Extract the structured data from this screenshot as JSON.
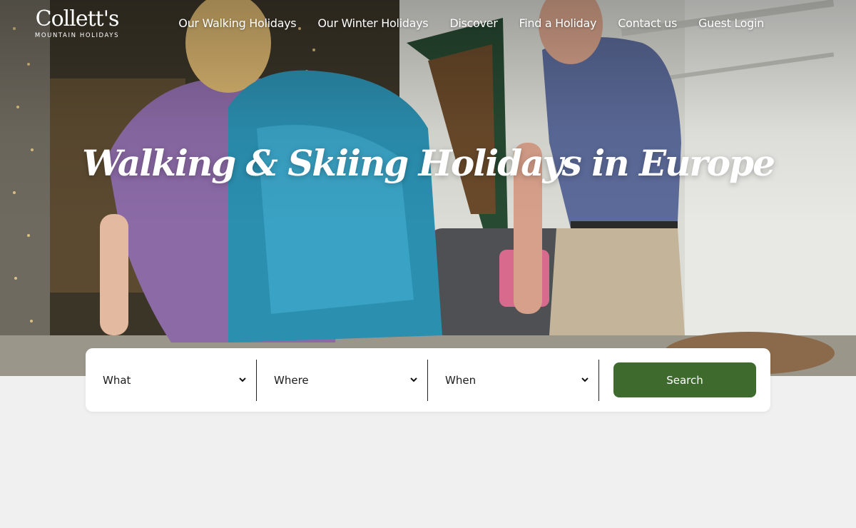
{
  "brand": {
    "wordmark": "Collett's",
    "tagline": "MOUNTAIN HOLIDAYS"
  },
  "nav": {
    "items": [
      {
        "label": "Our Walking Holidays"
      },
      {
        "label": "Our Winter Holidays"
      },
      {
        "label": "Discover"
      },
      {
        "label": "Find a Holiday"
      },
      {
        "label": "Contact us"
      },
      {
        "label": "Guest Login"
      }
    ]
  },
  "hero": {
    "headline": "Walking & Skiing Holidays in Europe",
    "image_icon": "hero-photo-couple-walking"
  },
  "search": {
    "fields": [
      {
        "label": "What",
        "icon": "chevron-down-icon"
      },
      {
        "label": "Where",
        "icon": "chevron-down-icon"
      },
      {
        "label": "When",
        "icon": "chevron-down-icon"
      }
    ],
    "button_label": "Search"
  },
  "colors": {
    "accent_green": "#3e6a2e",
    "page_bg": "#f0f0f0",
    "panel_bg": "#ffffff"
  }
}
